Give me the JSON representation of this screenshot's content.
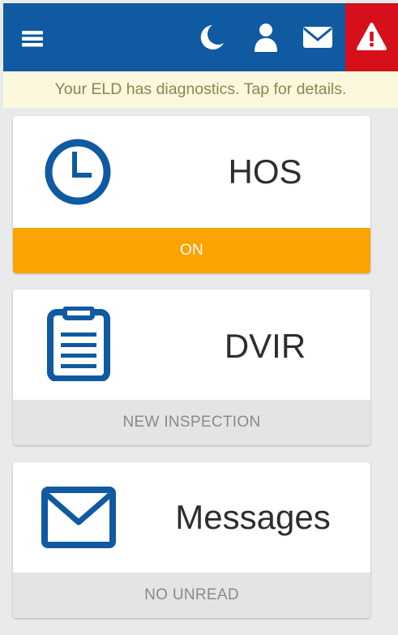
{
  "colors": {
    "brand_blue": "#0f5aa1",
    "alert_red": "#d6101b",
    "status_on": "#fba301",
    "banner_bg": "#fcf8dd"
  },
  "app_bar": {
    "icons": [
      "menu-icon",
      "moon-icon",
      "user-icon",
      "mail-icon",
      "warning-icon"
    ]
  },
  "banner": {
    "text": "Your ELD has diagnostics. Tap for details."
  },
  "cards": {
    "hos": {
      "icon": "clock-icon",
      "title": "HOS",
      "status": "ON"
    },
    "dvir": {
      "icon": "clipboard-icon",
      "title": "DVIR",
      "status": "NEW INSPECTION"
    },
    "messages": {
      "icon": "envelope-icon",
      "title": "Messages",
      "status": "NO UNREAD"
    }
  }
}
